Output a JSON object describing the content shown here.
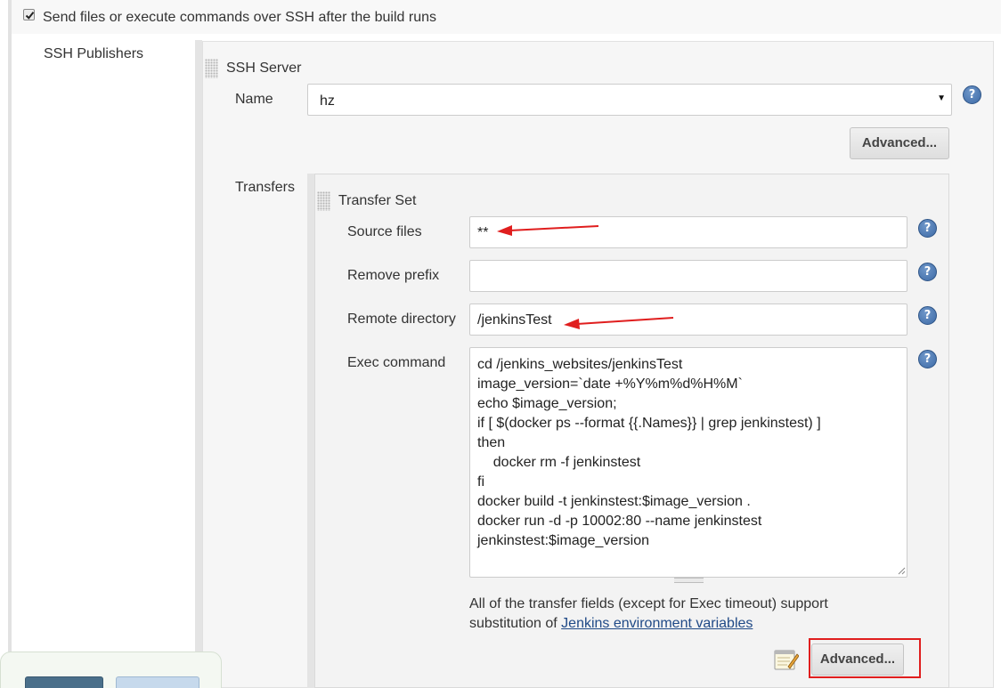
{
  "post_build": {
    "checkbox_label": "Send files or execute commands over SSH after the build runs",
    "checked": true,
    "section_label": "SSH Publishers"
  },
  "ssh_server": {
    "title": "SSH Server",
    "name_label": "Name",
    "name_value": "hz",
    "advanced_label": "Advanced..."
  },
  "transfers": {
    "label": "Transfers",
    "set_title": "Transfer Set",
    "source_files_label": "Source files",
    "source_files_value": "**",
    "remove_prefix_label": "Remove prefix",
    "remove_prefix_value": "",
    "remote_directory_label": "Remote directory",
    "remote_directory_value": "/jenkinsTest",
    "exec_command_label": "Exec command",
    "exec_command_value": "cd /jenkins_websites/jenkinsTest\nimage_version=`date +%Y%m%d%H%M`\necho $image_version;\nif [ $(docker ps --format {{.Names}} | grep jenkinstest) ]\nthen\n    docker rm -f jenkinstest\nfi\ndocker build -t jenkinstest:$image_version .\ndocker run -d -p 10002:80 --name jenkinstest\njenkinstest:$image_version",
    "note_text": "All of the transfer fields (except for Exec timeout) support substitution of ",
    "note_link": "Jenkins environment variables",
    "advanced_label": "Advanced..."
  },
  "help_icon_glyph": "?",
  "icons": [
    "checkbox-icon",
    "drag-handle-icon",
    "help-icon",
    "dropdown-arrow-icon",
    "notepad-icon"
  ],
  "colors": {
    "accent_red": "#e01e1e",
    "help_blue": "#3d6aa6",
    "link_blue": "#204a87"
  }
}
